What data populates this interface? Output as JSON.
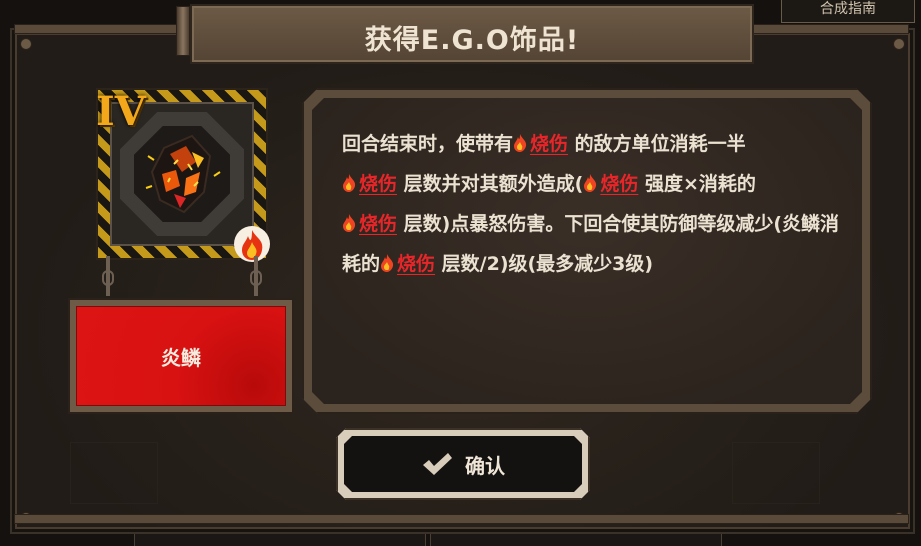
{
  "background": {
    "top_right_button": "合成指南"
  },
  "dialog": {
    "title": "获得E.G.O饰品!",
    "item": {
      "rank": "IV",
      "name": "炎鳞",
      "icon": "burning-scale-icon",
      "badge_icon": "fire-icon"
    },
    "description": {
      "keyword": "烧伤",
      "keyword_icon": "fire-icon",
      "seg1": "回合结束时，使带有",
      "seg2": "的敌方单位消耗一半",
      "seg3": "层数并对其额外造成(",
      "seg4": "强度×消耗的",
      "seg5": "层数)点暴怒伤害。下回合使其防御等级减少(炎鳞消耗的",
      "seg6": "层数/2)级(最多减少3级)"
    },
    "confirm_button": {
      "label": "确认",
      "icon": "checkmark-icon"
    }
  },
  "colors": {
    "keyword": "#e8262a",
    "name_plate": "#dd1414",
    "rank": "#f2a81a",
    "hazard_stripe": "#c59a1a"
  }
}
